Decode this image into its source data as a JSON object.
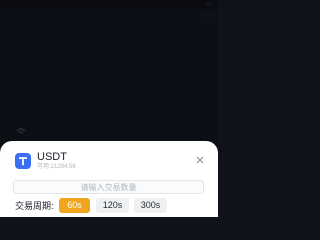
{
  "coin": {
    "name": "USDT",
    "subtitle": "可用:21294.56",
    "icon": "tether-icon"
  },
  "amount_input": {
    "value": "",
    "placeholder": "请输入交易数量"
  },
  "trade_period": {
    "label": "交易周期:",
    "options": [
      "60s",
      "120s",
      "300s"
    ],
    "selected": "60s"
  },
  "colors": {
    "accent": "#f0a51e",
    "brand": "#3b6ff5",
    "backdrop": "#0c0f15"
  }
}
